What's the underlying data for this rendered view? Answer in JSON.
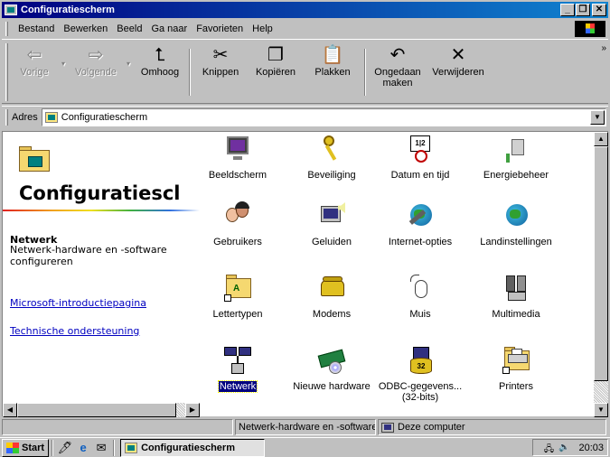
{
  "window": {
    "title": "Configuratiescherm",
    "controls": [
      "_",
      "❐",
      "✕"
    ]
  },
  "menu": {
    "items": [
      "Bestand",
      "Bewerken",
      "Beeld",
      "Ga naar",
      "Favorieten",
      "Help"
    ]
  },
  "toolbar": {
    "back": "Vorige",
    "forward": "Volgende",
    "up": "Omhoog",
    "cut": "Knippen",
    "copy": "Kopiëren",
    "paste": "Plakken",
    "undo_line1": "Ongedaan",
    "undo_line2": "maken",
    "delete": "Verwijderen",
    "more": "»"
  },
  "address": {
    "label": "Adres",
    "value": "Configuratiescherm"
  },
  "left_pane": {
    "title": "Configuratiescl",
    "selected_title": "Netwerk",
    "selected_desc": "Netwerk-hardware en -software configureren",
    "link1": "Microsoft-introductiepagina",
    "link2": "Technische ondersteuning"
  },
  "items": [
    {
      "label": "Beeldscherm",
      "icon": "display-icon"
    },
    {
      "label": "Beveiliging",
      "icon": "keys-icon"
    },
    {
      "label": "Datum en tijd",
      "icon": "calendar-clock-icon"
    },
    {
      "label": "Energiebeheer",
      "icon": "power-plug-icon"
    },
    {
      "label": "Gebruikers",
      "icon": "users-icon"
    },
    {
      "label": "Geluiden",
      "icon": "speaker-computer-icon"
    },
    {
      "label": "Internet-opties",
      "icon": "globe-tools-icon"
    },
    {
      "label": "Landinstellingen",
      "icon": "globe-icon"
    },
    {
      "label": "Lettertypen",
      "icon": "fonts-folder-icon"
    },
    {
      "label": "Modems",
      "icon": "phone-icon"
    },
    {
      "label": "Muis",
      "icon": "mouse-icon"
    },
    {
      "label": "Multimedia",
      "icon": "multimedia-icon"
    },
    {
      "label": "Netwerk",
      "icon": "network-icon"
    },
    {
      "label": "Nieuwe hardware",
      "icon": "hardware-card-icon"
    },
    {
      "label_line1": "ODBC-gegevens...",
      "label_line2": "(32-bits)",
      "icon": "odbc-icon"
    },
    {
      "label": "Printers",
      "icon": "printer-folder-icon"
    }
  ],
  "status": {
    "text": "Netwerk-hardware en -software confi",
    "zone": "Deze computer"
  },
  "taskbar": {
    "start": "Start",
    "task": "Configuratiescherm",
    "time": "20:03"
  }
}
